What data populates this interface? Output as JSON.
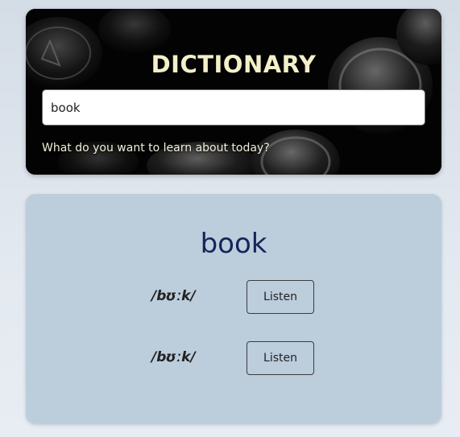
{
  "header": {
    "title": "DICTIONARY",
    "hint": "What do you want to learn about today?"
  },
  "search": {
    "value": "book",
    "placeholder": ""
  },
  "result": {
    "word": "book",
    "phonetics": [
      {
        "text": "/bʊːk/",
        "button_label": "Listen"
      },
      {
        "text": "/bʊːk/",
        "button_label": "Listen"
      }
    ]
  },
  "colors": {
    "title": "#f3efc8",
    "word": "#14255a",
    "card": "#bccddc"
  },
  "icons": {
    "hero_background": "typewriter-keys-photo"
  }
}
